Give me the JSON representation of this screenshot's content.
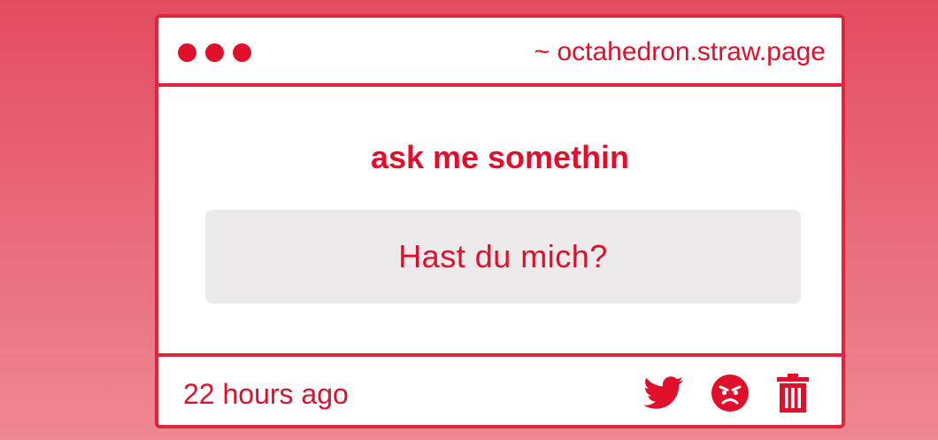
{
  "window": {
    "url": "~ octahedron.straw.page",
    "dots": [
      "dot",
      "dot",
      "dot"
    ]
  },
  "main": {
    "heading": "ask me somethin",
    "question": "Hast du mich?"
  },
  "footer": {
    "timestamp": "22 hours ago",
    "actions": [
      {
        "icon": "twitter-icon"
      },
      {
        "icon": "angry-face-icon"
      },
      {
        "icon": "trash-icon"
      }
    ]
  },
  "colors": {
    "accent": "#e0102c",
    "border": "#e0243c",
    "question_bg": "#eceaeb",
    "background_top": "#e44c62",
    "background_bottom": "#ee8892"
  }
}
